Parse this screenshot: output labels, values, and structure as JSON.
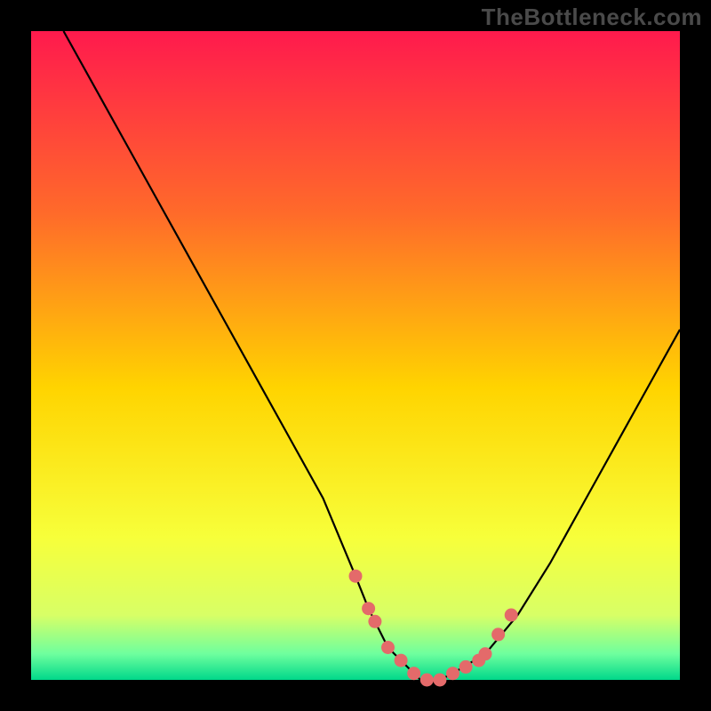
{
  "watermark": "TheBottleneck.com",
  "colors": {
    "bg": "#000000",
    "grad_top": "#ff1a4d",
    "grad_mid1": "#ff6a2a",
    "grad_mid2": "#ffd400",
    "grad_mid3": "#f7ff3a",
    "grad_bot1": "#d8ff66",
    "grad_bot2": "#6eff9e",
    "grad_bot3": "#00d88a",
    "curve": "#000000",
    "dot": "#e46a6a"
  },
  "chart_data": {
    "type": "line",
    "title": "",
    "xlabel": "",
    "ylabel": "",
    "xlim": [
      0,
      100
    ],
    "ylim": [
      0,
      100
    ],
    "series": [
      {
        "name": "bottleneck-curve",
        "x": [
          5,
          10,
          15,
          20,
          25,
          30,
          35,
          40,
          45,
          50,
          52,
          55,
          58,
          60,
          63,
          65,
          70,
          75,
          80,
          85,
          90,
          95,
          100
        ],
        "y": [
          100,
          91,
          82,
          73,
          64,
          55,
          46,
          37,
          28,
          16,
          11,
          5,
          2,
          0,
          0,
          1,
          4,
          10,
          18,
          27,
          36,
          45,
          54
        ]
      }
    ],
    "dots": {
      "name": "highlight-dots",
      "x": [
        50,
        52,
        53,
        55,
        57,
        59,
        61,
        63,
        65,
        67,
        69,
        70,
        72,
        74
      ],
      "y": [
        16,
        11,
        9,
        5,
        3,
        1,
        0,
        0,
        1,
        2,
        3,
        4,
        7,
        10
      ]
    }
  }
}
